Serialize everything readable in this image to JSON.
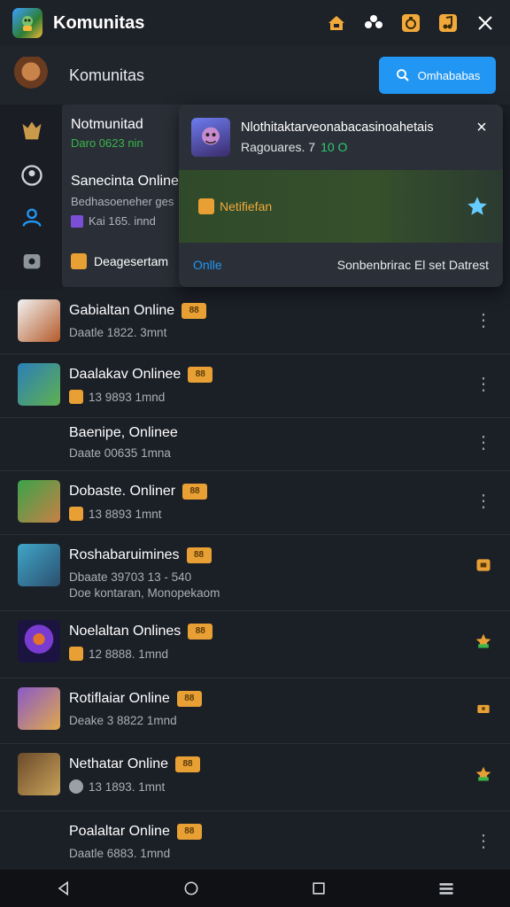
{
  "app": {
    "title": "Komunitas"
  },
  "subheader": {
    "title": "Komunitas",
    "cta_label": "Omhababas"
  },
  "background_card": {
    "title": "Notmunitad",
    "title_sub": "Daro 0623 nin",
    "row2": "Sanecinta Online",
    "row2_sub": "Bedhasoeneher ges",
    "row2_meta": "Kai 165. innd",
    "row3": "Deagesertam"
  },
  "popup": {
    "name": "Nlothitaktarveonabacasinoahetais",
    "subtitle": "Ragouares. 7",
    "highlight": "10 O",
    "tag_label": "Netifiefan",
    "footer_left": "Onlle",
    "footer_right": "Sonbenbrirac El set Datrest",
    "close_label": "×"
  },
  "list": [
    {
      "name": "Gabialtan Online",
      "badge": "88",
      "meta": "Daatle 1822. 3mnt",
      "colors": [
        "#f0f0f0",
        "#b55a2a"
      ]
    },
    {
      "name": "Daalakav Onlinee",
      "badge": "88",
      "meta": "13 9893 1mnd",
      "colors": [
        "#2b7fb8",
        "#5fb04f"
      ]
    },
    {
      "name": "Baenipe, Onlinee",
      "badge": "",
      "meta": "Daate 00635 1mna",
      "colors": null
    },
    {
      "name": "Dobaste. Onliner",
      "badge": "88",
      "meta": "13 8893 1mnt",
      "colors": [
        "#3aa34a",
        "#c98045"
      ]
    },
    {
      "name": "Roshabaruimines",
      "badge": "88",
      "meta": "Dbaate 39703 13 - 540",
      "meta2": "Doe kontaran, Monopekaom",
      "colors": [
        "#3fa6c9",
        "#2c4f6e"
      ]
    },
    {
      "name": "Noelaltan Onlines",
      "badge": "88",
      "meta": "12 8888. 1mnd",
      "colors": [
        "#1c1440",
        "#7a3bd1"
      ]
    },
    {
      "name": "Rotiflaiar Online",
      "badge": "88",
      "meta": "Deake 3 8822 1mnd",
      "colors": [
        "#8a5ac9",
        "#e0a84a"
      ]
    },
    {
      "name": "Nethatar Online",
      "badge": "88",
      "meta": "13 1893. 1mnt",
      "colors": [
        "#6a4a2a",
        "#c9a35a"
      ]
    },
    {
      "name": "Poalaltar Online",
      "badge": "88",
      "meta": "Daatle 6883. 1mnd",
      "colors": null
    }
  ],
  "accent": "#2196f3",
  "badge_color": "#e8a034"
}
